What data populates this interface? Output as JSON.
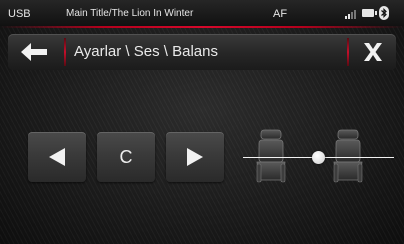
{
  "status": {
    "source": "USB",
    "track": "Main Title/The Lion In Winter",
    "af": "AF",
    "icons": [
      "signal-icon",
      "battery-icon",
      "bluetooth-icon"
    ]
  },
  "header": {
    "title": "Ayarlar \\ Ses \\ Balans",
    "back_icon": "arrow-left-icon",
    "close_icon": "close-x-icon"
  },
  "balance": {
    "left_icon": "triangle-left-icon",
    "center_label": "C",
    "right_icon": "triangle-right-icon",
    "level": 0.5
  },
  "colors": {
    "accent": "#d6082b",
    "text": "#e6e6e6"
  }
}
